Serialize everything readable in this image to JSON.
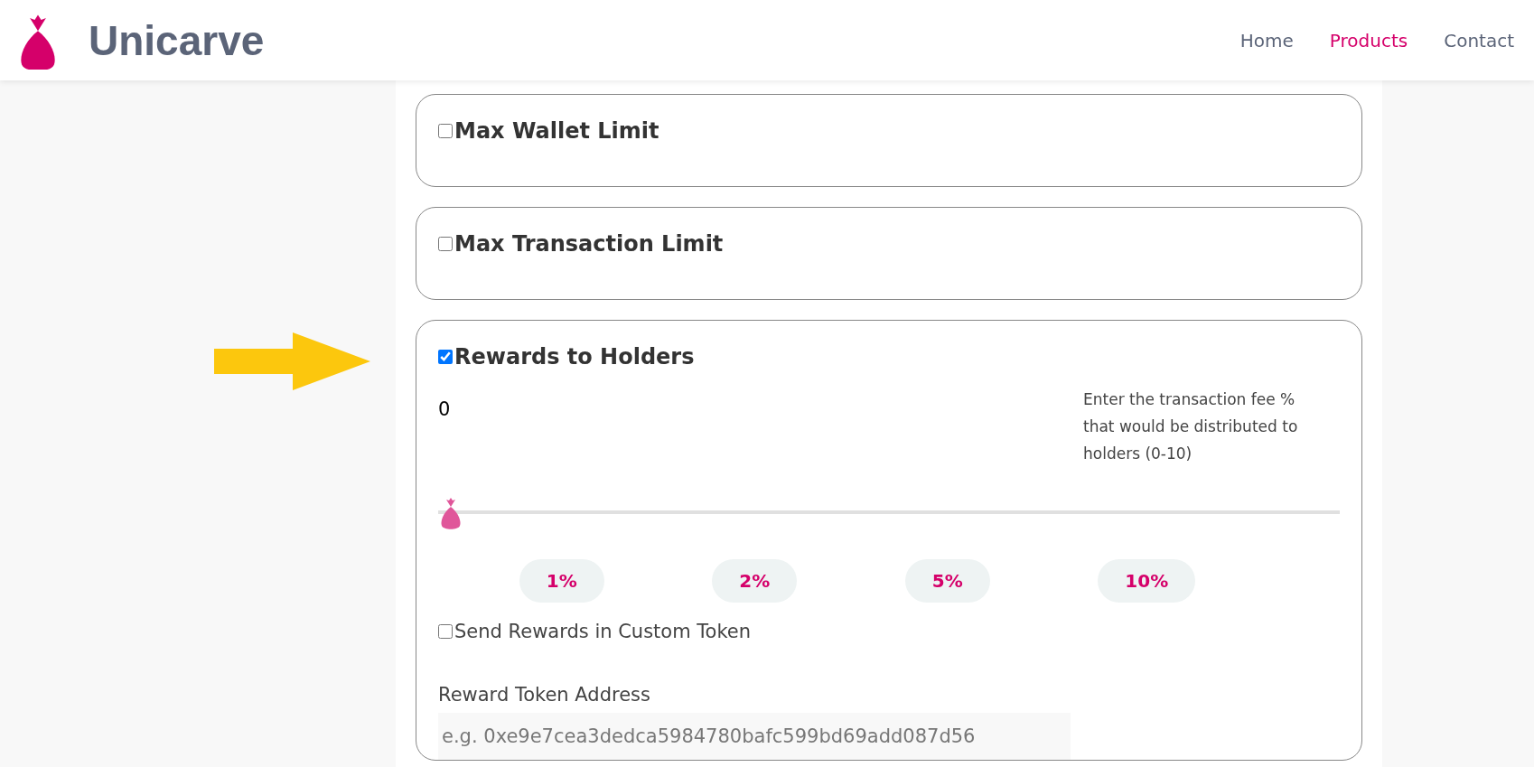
{
  "header": {
    "brand": "Unicarve",
    "nav": [
      {
        "label": "Home",
        "selected": false
      },
      {
        "label": "Products",
        "selected": true
      },
      {
        "label": "Contact",
        "selected": false
      }
    ]
  },
  "options": [
    {
      "title": "Max Wallet Limit",
      "checked": false
    },
    {
      "title": "Max Transaction Limit",
      "checked": false
    },
    {
      "title": "Rewards to Holders",
      "checked": true,
      "value": "0",
      "hint": "Enter the transaction fee % that would be distributed to holders (0-10)",
      "slider": {
        "level": 0
      },
      "presets": [
        "1%",
        "2%",
        "5%",
        "10%"
      ],
      "custom_token": {
        "label": "Send Rewards in Custom Token",
        "checked": false
      },
      "address": {
        "label": "Reward Token Address",
        "placeholder": "e.g. 0xe9e7cea3dedca5984780bafc599bd69add087d56"
      }
    }
  ]
}
